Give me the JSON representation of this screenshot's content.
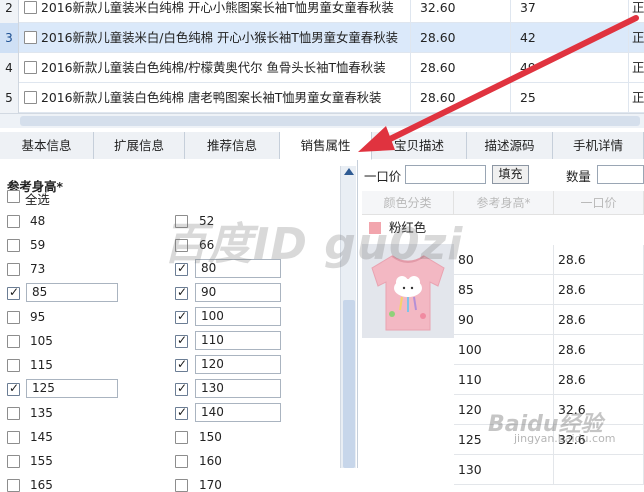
{
  "products": {
    "rows": [
      {
        "num": "2",
        "name": "2016新款儿童装米白纯棉 开心小熊图案长袖T恤男童女童春秋装",
        "price": "32.60",
        "qty": "37",
        "extra": "正",
        "checked": false,
        "selected": false
      },
      {
        "num": "3",
        "name": "2016新款儿童装米白/白色纯棉 开心小猴长袖T恤男童女童春秋装",
        "price": "28.60",
        "qty": "42",
        "extra": "正",
        "checked": false,
        "selected": true
      },
      {
        "num": "4",
        "name": "2016新款儿童装白色纯棉/柠檬黄奥代尔 鱼骨头长袖T恤春秋装",
        "price": "28.60",
        "qty": "49",
        "extra": "正",
        "checked": false,
        "selected": false
      },
      {
        "num": "5",
        "name": "2016新款儿童装白色纯棉 唐老鸭图案长袖T恤男童女童春秋装",
        "price": "28.60",
        "qty": "25",
        "extra": "正",
        "checked": false,
        "selected": false
      }
    ]
  },
  "tabs": [
    "基本信息",
    "扩展信息",
    "推荐信息",
    "销售属性",
    "宝贝描述",
    "描述源码",
    "手机详情"
  ],
  "active_tab": "销售属性",
  "size_panel": {
    "title": "参考身高*",
    "select_all": "全选",
    "left_options": [
      {
        "label": "48",
        "checked": false,
        "input": false
      },
      {
        "label": "59",
        "checked": false,
        "input": false
      },
      {
        "label": "73",
        "checked": false,
        "input": false
      },
      {
        "label": "85",
        "checked": true,
        "input": true
      },
      {
        "label": "95",
        "checked": false,
        "input": false
      },
      {
        "label": "105",
        "checked": false,
        "input": false
      },
      {
        "label": "115",
        "checked": false,
        "input": false
      },
      {
        "label": "125",
        "checked": true,
        "input": true
      },
      {
        "label": "135",
        "checked": false,
        "input": false
      },
      {
        "label": "145",
        "checked": false,
        "input": false
      },
      {
        "label": "155",
        "checked": false,
        "input": false
      },
      {
        "label": "165",
        "checked": false,
        "input": false
      }
    ],
    "right_options": [
      {
        "label": "52",
        "checked": false,
        "input": false
      },
      {
        "label": "66",
        "checked": false,
        "input": false
      },
      {
        "label": "80",
        "checked": true,
        "input": true
      },
      {
        "label": "90",
        "checked": true,
        "input": true
      },
      {
        "label": "100",
        "checked": true,
        "input": true
      },
      {
        "label": "110",
        "checked": true,
        "input": true
      },
      {
        "label": "120",
        "checked": true,
        "input": true
      },
      {
        "label": "130",
        "checked": true,
        "input": true
      },
      {
        "label": "140",
        "checked": true,
        "input": true
      },
      {
        "label": "150",
        "checked": false,
        "input": false
      },
      {
        "label": "160",
        "checked": false,
        "input": false
      },
      {
        "label": "170",
        "checked": false,
        "input": false
      }
    ]
  },
  "sku_panel": {
    "price_label": "一口价",
    "fill_button": "填充",
    "qty_label": "数量",
    "headers": [
      "颜色分类",
      "参考身高*",
      "一口价"
    ],
    "color_name": "粉红色",
    "color_swatch": "#f2a5ad",
    "rows": [
      {
        "height": "80",
        "price": "28.6"
      },
      {
        "height": "85",
        "price": "28.6"
      },
      {
        "height": "90",
        "price": "28.6"
      },
      {
        "height": "100",
        "price": "28.6"
      },
      {
        "height": "110",
        "price": "28.6"
      },
      {
        "height": "120",
        "price": "32.6"
      },
      {
        "height": "125",
        "price": "32.6"
      },
      {
        "height": "130",
        "price": ""
      }
    ]
  },
  "watermark": {
    "text": "百度ID gu0zi",
    "logo": "Baidu经验",
    "url": "jingyan.baidu.com"
  },
  "colors": {
    "accent_arrow": "#e0333f",
    "selected_row": "#dbe9fa"
  }
}
